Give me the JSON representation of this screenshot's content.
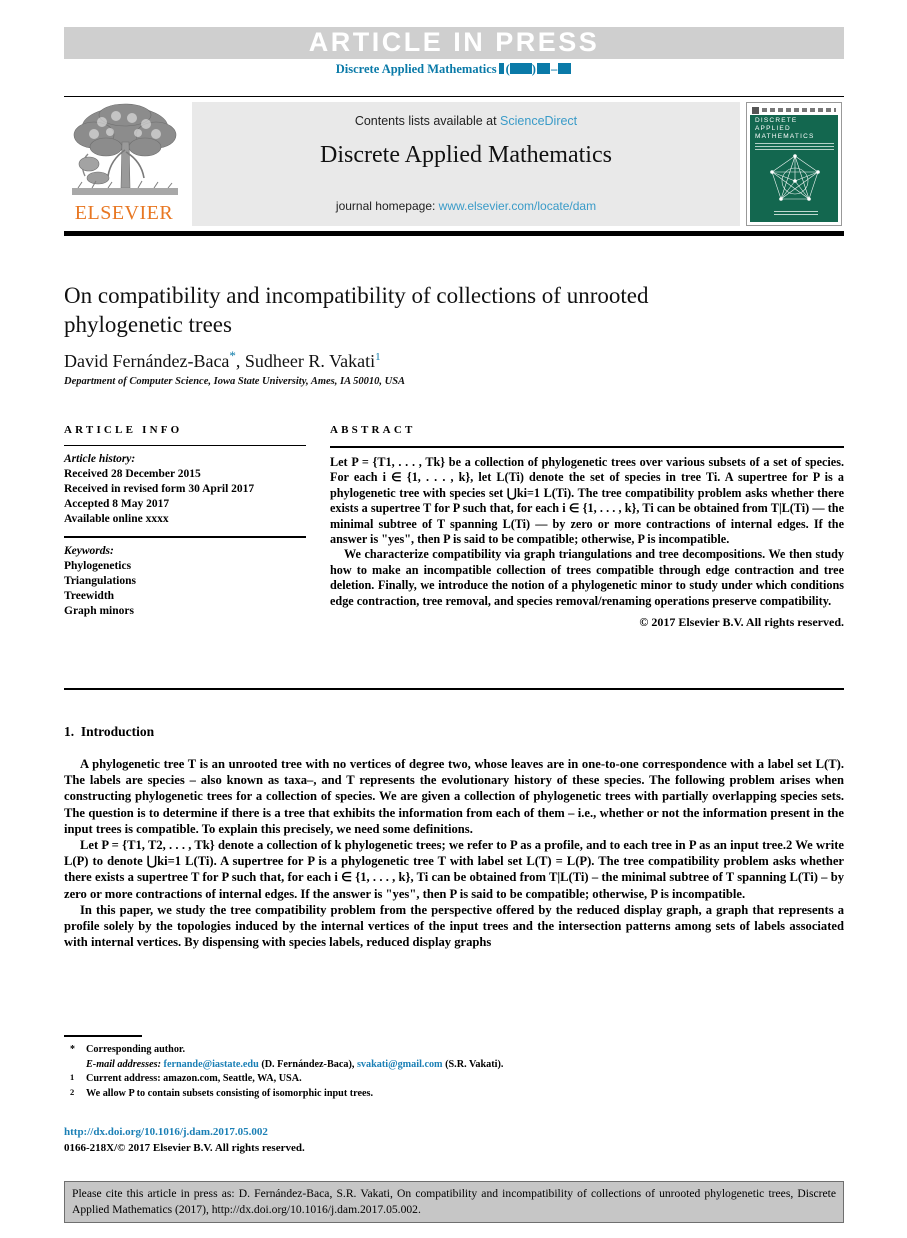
{
  "banner": {
    "article_in_press": "ARTICLE  IN  PRESS",
    "journal_ref_prefix": "Discrete Applied Mathematics",
    "accent_color": "#0a7aa8",
    "band_color": "#cfcfcf"
  },
  "masthead": {
    "contents_prefix": "Contents lists available at ",
    "contents_link": "ScienceDirect",
    "journal_name": "Discrete Applied Mathematics",
    "homepage_prefix": "journal homepage: ",
    "homepage_link": "www.elsevier.com/locate/dam",
    "publisher": "ELSEVIER",
    "publisher_color": "#e87722",
    "cover": {
      "line1": "DISCRETE",
      "line2": "APPLIED",
      "line3": "MATHEMATICS",
      "bg_color": "#13674f"
    }
  },
  "article": {
    "title": "On compatibility and incompatibility of collections of unrooted phylogenetic trees",
    "author1": "David Fernández-Baca",
    "author1_mark": "*",
    "author_sep": ", ",
    "author2": "Sudheer R. Vakati",
    "author2_mark": "1",
    "affiliation": "Department of Computer Science, Iowa State University, Ames, IA 50010, USA"
  },
  "info": {
    "heading": "ARTICLE INFO",
    "history_label": "Article history:",
    "history": [
      "Received 28 December 2015",
      "Received in revised form 30 April 2017",
      "Accepted 8 May 2017",
      "Available online xxxx"
    ],
    "keywords_label": "Keywords:",
    "keywords": [
      "Phylogenetics",
      "Triangulations",
      "Treewidth",
      "Graph minors"
    ]
  },
  "abstract": {
    "heading": "ABSTRACT",
    "para1": "Let P = {T1, . . . , Tk} be a collection of phylogenetic trees over various subsets of a set of species. For each i ∈ {1, . . . , k}, let L(Ti) denote the set of species in tree Ti. A supertree for P is a phylogenetic tree with species set ⋃ki=1 L(Ti). The tree compatibility problem asks whether there exists a supertree T for P such that, for each i ∈ {1, . . . , k}, Ti can be obtained from T|L(Ti) — the minimal subtree of T spanning L(Ti) — by zero or more contractions of internal edges. If the answer is \"yes\", then P is said to be compatible; otherwise, P is incompatible.",
    "para2": "We characterize compatibility via graph triangulations and tree decompositions. We then study how to make an incompatible collection of trees compatible through edge contraction and tree deletion. Finally, we introduce the notion of a phylogenetic minor to study under which conditions edge contraction, tree removal, and species removal/renaming operations preserve compatibility.",
    "copyright": "© 2017 Elsevier B.V. All rights reserved."
  },
  "body": {
    "section_number": "1.",
    "section_title": "Introduction",
    "para1": "A phylogenetic tree T is an unrooted tree with no vertices of degree two, whose leaves are in one-to-one correspondence with a label set L(T). The labels are species – also known as taxa–, and T represents the evolutionary history of these species. The following problem arises when constructing phylogenetic trees for a collection of species. We are given a collection of phylogenetic trees with partially overlapping species sets. The question is to determine if there is a tree that exhibits the information from each of them – i.e., whether or not the information present in the input trees is compatible. To explain this precisely, we need some definitions.",
    "para2": "Let P = {T1, T2, . . . , Tk} denote a collection of k phylogenetic trees; we refer to P as a profile, and to each tree in P as an input tree.2 We write L(P) to denote ⋃ki=1 L(Ti). A supertree for P is a phylogenetic tree T with label set L(T) = L(P). The tree compatibility problem asks whether there exists a supertree T for P such that, for each i ∈ {1, . . . , k}, Ti can be obtained from T|L(Ti) – the minimal subtree of T spanning L(Ti) – by zero or more contractions of internal edges. If the answer is \"yes\", then P is said to be compatible; otherwise, P is incompatible.",
    "para3": "In this paper, we study the tree compatibility problem from the perspective offered by the reduced display graph, a graph that represents a profile solely by the topologies induced by the internal vertices of the input trees and the intersection patterns among sets of labels associated with internal vertices. By dispensing with species labels, reduced display graphs"
  },
  "footnotes": {
    "star_mark": "*",
    "star_text": "Corresponding author.",
    "email_label": "E-mail addresses:",
    "email1": "fernande@iastate.edu",
    "email1_owner": "(D. Fernández-Baca)",
    "email2": "svakati@gmail.com",
    "email2_owner": "(S.R. Vakati).",
    "note1_mark": "1",
    "note1_text": "Current address: amazon.com, Seattle, WA, USA.",
    "note2_mark": "2",
    "note2_text": "We allow P to contain subsets consisting of isomorphic input trees.",
    "doi": "http://dx.doi.org/10.1016/j.dam.2017.05.002",
    "issn": "0166-218X/© 2017 Elsevier B.V. All rights reserved."
  },
  "cite_box": {
    "text": "Please cite this article in press as: D. Fernández-Baca, S.R. Vakati, On compatibility and incompatibility of collections of unrooted phylogenetic trees, Discrete Applied Mathematics (2017), http://dx.doi.org/10.1016/j.dam.2017.05.002.",
    "bg_color": "#c6c6c6"
  }
}
